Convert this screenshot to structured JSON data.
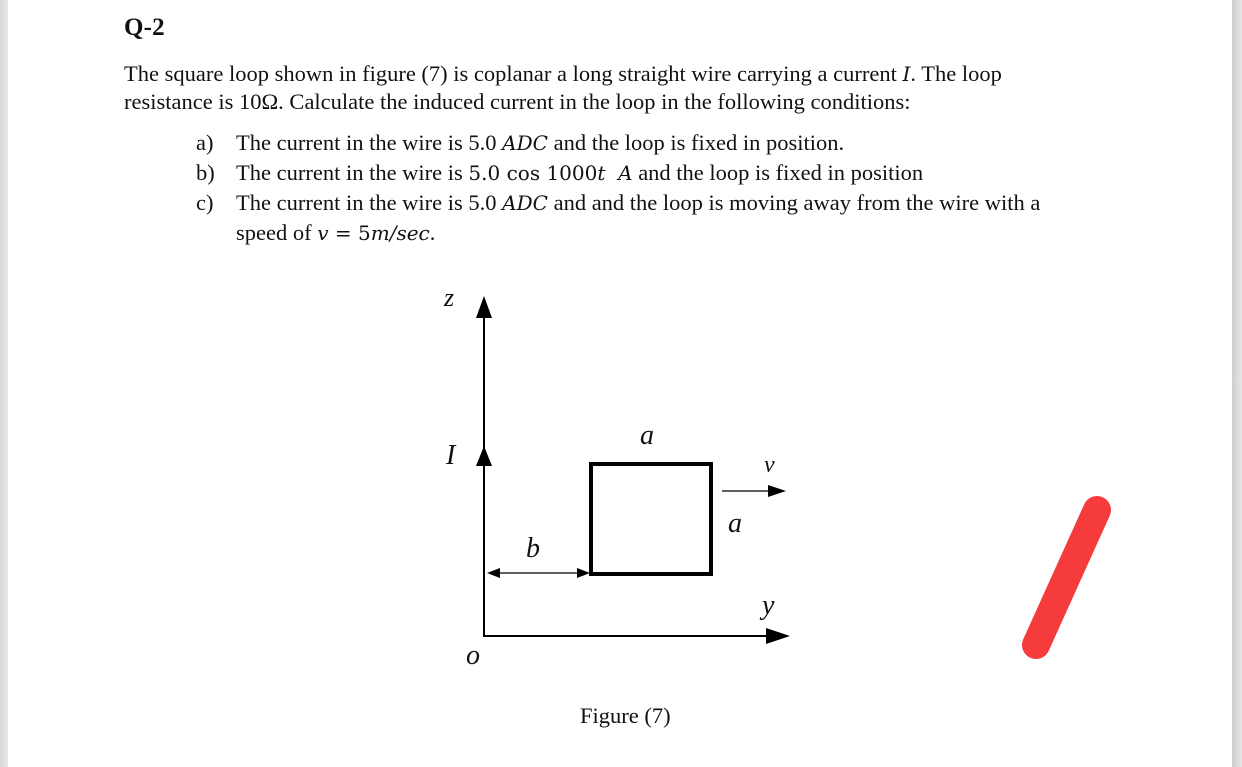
{
  "question": {
    "title": "Q-2",
    "intro_line1_pre": "The square loop shown in figure (7) is coplanar a long straight wire carrying a current ",
    "intro_var": "I",
    "intro_line1_post": ". The loop",
    "intro_line2": "resistance is 10Ω. Calculate the induced current in the loop in the following conditions:"
  },
  "conditions": [
    {
      "label": "a)",
      "pre": "The current in the wire is 5.0 ",
      "math": "ADC",
      "post": " and the loop is fixed in position."
    },
    {
      "label": "b)",
      "pre": "The current in the wire is ",
      "math_upright": "5.0 cos 1000",
      "math": "t  A",
      "post": " and the loop is fixed in position"
    },
    {
      "label": "c)",
      "pre": "The current in the wire is 5.0 ",
      "math": "ADC",
      "post": " and and the loop is moving away from the wire with a",
      "line2_pre": "speed of ",
      "line2_math_v": "v",
      "line2_math_eq": " = 5",
      "line2_math_unit": "m/sec",
      "line2_post": "."
    }
  ],
  "figure": {
    "caption": "Figure (7)",
    "labels": {
      "z_axis": "z",
      "y_axis": "y",
      "origin": "o",
      "current": "I",
      "side_top": "a",
      "side_right": "a",
      "distance": "b",
      "velocity": "v"
    }
  },
  "annotation": {
    "color": "#f53b3b"
  }
}
